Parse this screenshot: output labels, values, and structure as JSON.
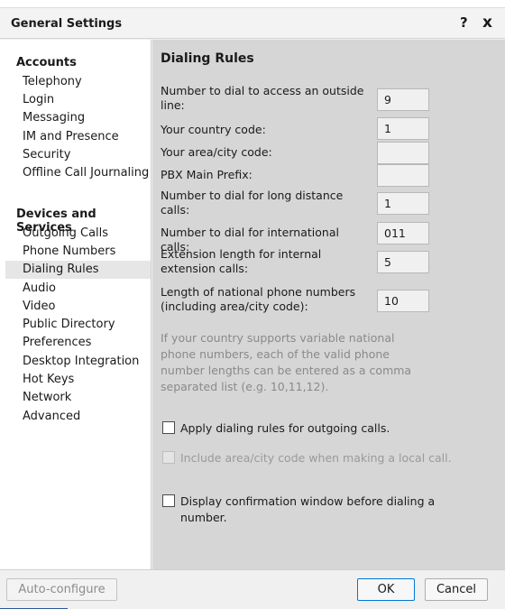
{
  "window": {
    "title": "General Settings",
    "help_label": "?",
    "close_label": "x"
  },
  "sidebar": {
    "groups": [
      {
        "title": "Accounts",
        "items": [
          "Telephony",
          "Login",
          "Messaging",
          "IM and Presence",
          "Security",
          "Offline Call Journaling"
        ]
      },
      {
        "title": "Devices and Services",
        "items": [
          "Outgoing Calls",
          "Phone Numbers",
          "Dialing Rules",
          "Audio",
          "Video",
          "Public Directory",
          "Preferences",
          "Desktop Integration",
          "Hot Keys",
          "Network",
          "Advanced"
        ]
      }
    ],
    "selected": "Dialing Rules"
  },
  "content": {
    "heading": "Dialing Rules",
    "fields": [
      {
        "label": "Number to dial to access an outside line:",
        "value": "9"
      },
      {
        "label": "Your country code:",
        "value": "1"
      },
      {
        "label": "Your area/city code:",
        "value": ""
      },
      {
        "label": "PBX Main Prefix:",
        "value": ""
      },
      {
        "label": "Number to dial for long distance calls:",
        "value": "1"
      },
      {
        "label": "Number to dial for international calls:",
        "value": "011"
      },
      {
        "label": "Extension length for internal extension calls:",
        "value": "5"
      },
      {
        "label": "Length of national phone numbers (including area/city code):",
        "value": "10"
      }
    ],
    "note": "If your country supports variable national phone numbers, each of the valid phone number lengths can be entered as a comma separated list (e.g. 10,11,12).",
    "checkboxes": [
      {
        "label": "Apply dialing rules for outgoing calls.",
        "checked": false,
        "enabled": true
      },
      {
        "label": "Include area/city code when making a local call.",
        "checked": false,
        "enabled": false
      },
      {
        "label": "Display confirmation window before dialing a number.",
        "checked": false,
        "enabled": true
      }
    ]
  },
  "footer": {
    "auto_configure_label": "Auto-configure",
    "ok_label": "OK",
    "cancel_label": "Cancel"
  },
  "colors": {
    "content_background": "#d6d6d6",
    "sidebar_background": "#ffffff",
    "selected_item": "#e6e6e6",
    "note_text": "#8a8a8a"
  }
}
